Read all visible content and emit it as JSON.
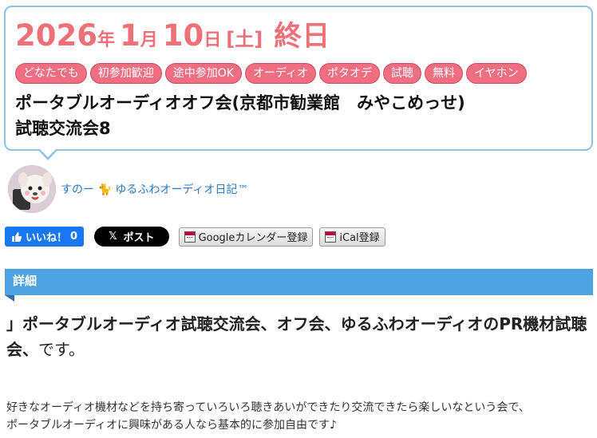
{
  "event": {
    "date": {
      "year": "2026",
      "year_suffix": "年",
      "month": "1",
      "month_suffix": "月",
      "day": "10",
      "day_suffix": "日",
      "weekday": "[土]",
      "allday": "終日"
    },
    "tags": [
      "どなたでも",
      "初参加歓迎",
      "途中参加OK",
      "オーディオ",
      "ポタオデ",
      "試聴",
      "無料",
      "イヤホン"
    ],
    "title_line1": "ポータブルオーディオオフ会(京都市勧業館　みやこめっせ)",
    "title_line2": "試聴交流会8"
  },
  "author": {
    "name": "すのー",
    "cat_icon": "🐈",
    "blog": "ゆるふわオーディオ日記™"
  },
  "share": {
    "like_label": "いいね！",
    "like_count": "0",
    "post_label": "ポスト",
    "x_icon": "𝕏",
    "google_cal_label": "Googleカレンダー登録",
    "ical_label": "iCal登録"
  },
  "section": {
    "title": "詳細"
  },
  "body": {
    "lead_bold": "」ポータブルオーディオ試聴交流会、オフ会、ゆるふわオーディオのPR機材試聴会、",
    "lead_plain": "です。",
    "desc_line1": "好きなオーディオ機材などを持ち寄っていろいろ聴きあいができたり交流できたら楽しいなという会で、",
    "desc_line2": "ポータブルオーディオに興味がある人なら基本的に参加自由です♪"
  },
  "colors": {
    "accent_pink": "#f0707a",
    "tag_pink": "#ef6e82",
    "card_border": "#8cc3e6",
    "section_blue": "#4ea2e0",
    "link_blue": "#2a7ac8",
    "facebook_blue": "#1877f2"
  }
}
